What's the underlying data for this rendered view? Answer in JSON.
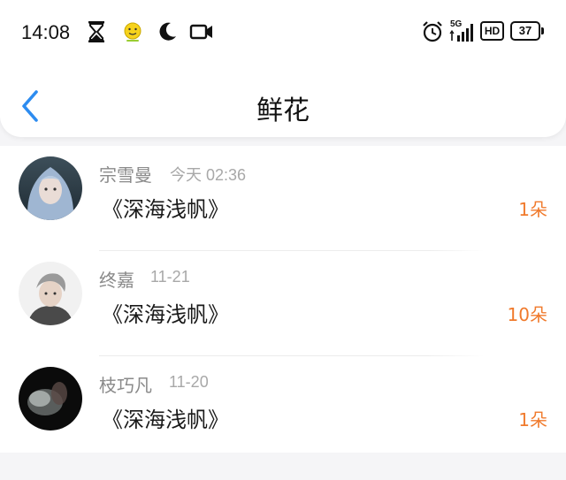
{
  "status_bar": {
    "time": "14:08",
    "network": "5G",
    "hd": "HD",
    "battery": "37"
  },
  "header": {
    "title": "鲜花"
  },
  "records": [
    {
      "name": "宗雪曼",
      "date": "今天 02:36",
      "work": "《深海浅帆》",
      "count": "1朵"
    },
    {
      "name": "终嘉",
      "date": "11-21",
      "work": "《深海浅帆》",
      "count": "10朵"
    },
    {
      "name": "枝巧凡",
      "date": "11-20",
      "work": "《深海浅帆》",
      "count": "1朵"
    }
  ],
  "colors": {
    "accent_blue": "#2d8cf0",
    "count_orange": "#f07a2c"
  }
}
